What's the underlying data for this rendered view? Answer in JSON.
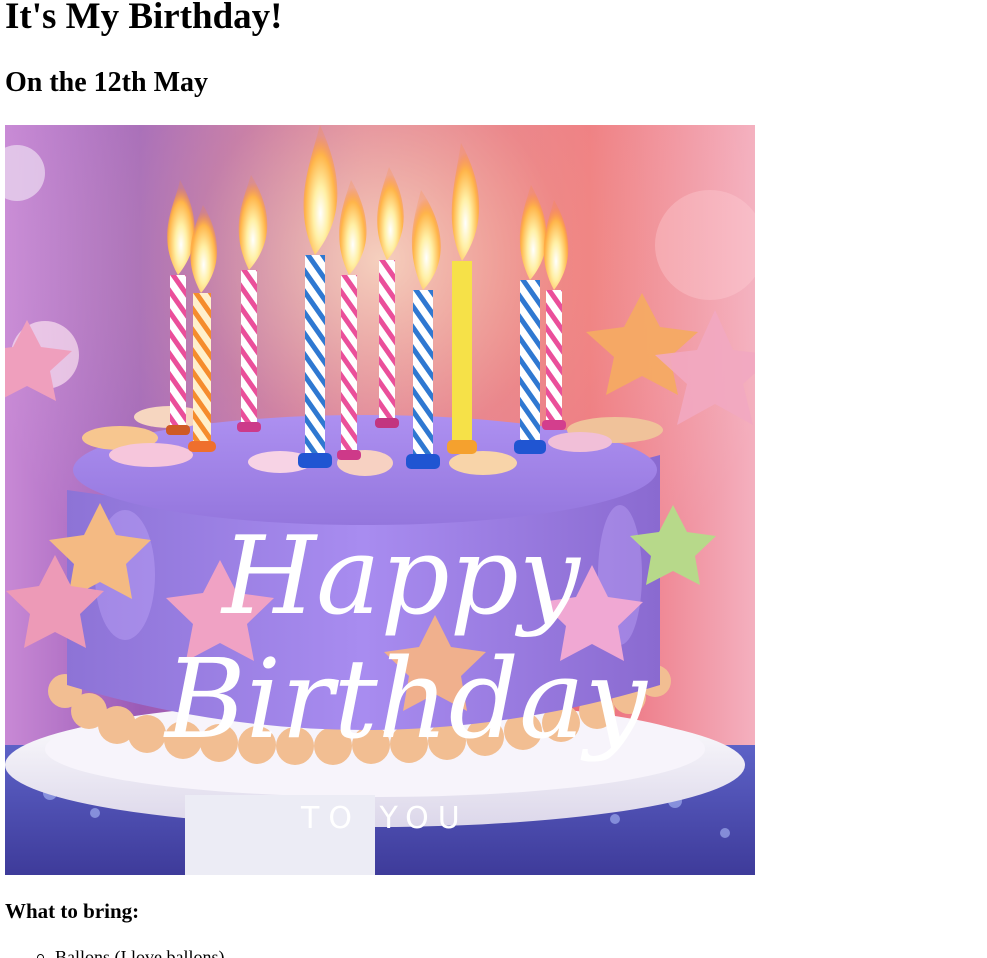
{
  "page": {
    "title": "It's My Birthday!",
    "date": "On the 12th May",
    "bring_heading": "What to bring:",
    "bring_items": [
      "Ballons (I love ballons)"
    ]
  },
  "image": {
    "script_line1": "Happy",
    "script_line2": "Birthday",
    "subtitle": "TO YOU"
  },
  "colors": {
    "frosting": "#9b7fe0",
    "plate": "#f1eef6",
    "accent_pink": "#f2a6c6",
    "accent_orange": "#f4b58a",
    "accent_green": "#b7d98a"
  }
}
